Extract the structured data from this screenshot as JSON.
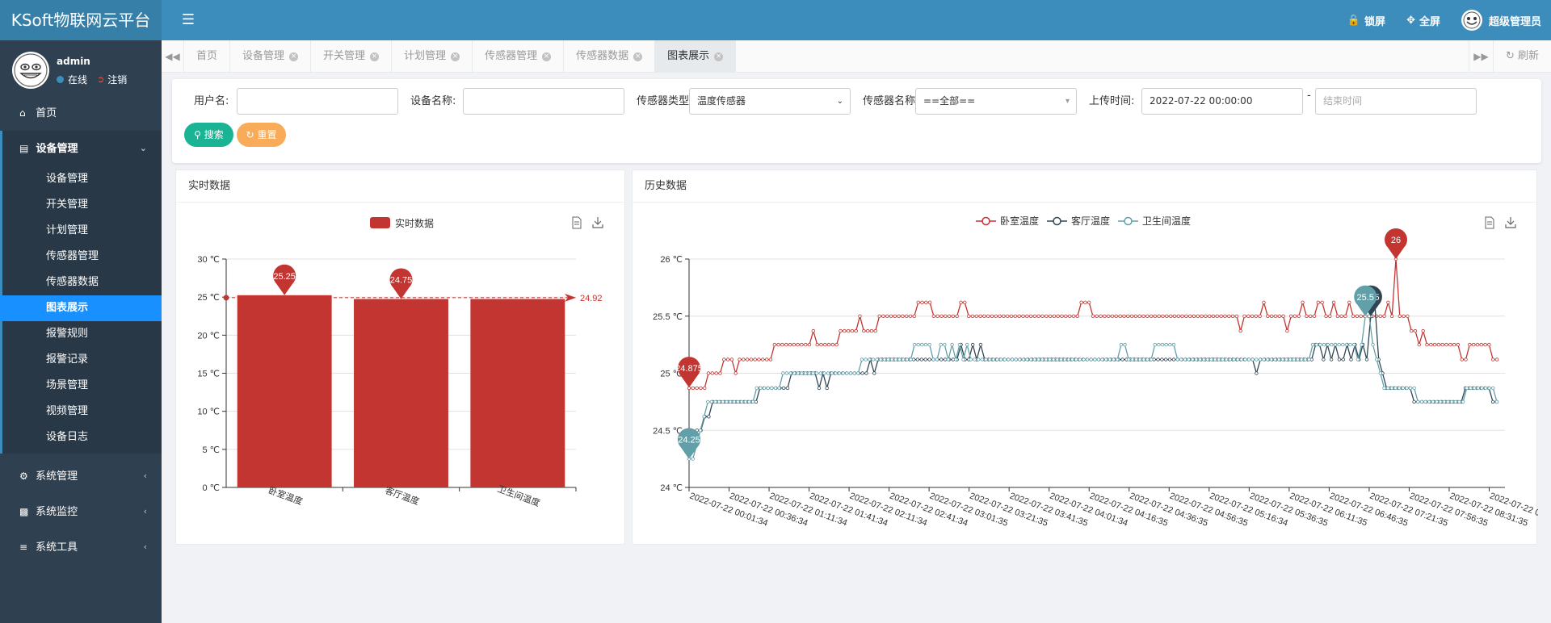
{
  "app": {
    "title": "KSoft物联网云平台"
  },
  "header": {
    "menu_icon": "hamburger-icon",
    "lock_label": "锁屏",
    "fullscreen_label": "全屏",
    "user_label": "超级管理员"
  },
  "sidebar": {
    "user": {
      "name": "admin",
      "status": "在线",
      "logout": "注销"
    },
    "home": "首页",
    "device_group": "设备管理",
    "items": [
      "设备管理",
      "开关管理",
      "计划管理",
      "传感器管理",
      "传感器数据",
      "图表展示",
      "报警规则",
      "报警记录",
      "场景管理",
      "视频管理",
      "设备日志"
    ],
    "active_item": "图表展示",
    "system_manage": "系统管理",
    "system_monitor": "系统监控",
    "system_tools": "系统工具"
  },
  "tabs": {
    "items": [
      "首页",
      "设备管理",
      "开关管理",
      "计划管理",
      "传感器管理",
      "传感器数据",
      "图表展示"
    ],
    "active": "图表展示",
    "refresh_label": "刷新"
  },
  "search": {
    "username_label": "用户名:",
    "username_value": "",
    "device_label": "设备名称:",
    "device_value": "",
    "sensor_type_label": "传感器类型",
    "sensor_type_value": "温度传感器",
    "sensor_name_label": "传感器名称",
    "sensor_name_value": "==全部==",
    "upload_time_label": "上传时间:",
    "start_time_value": "2022-07-22 00:00:00",
    "time_separator": "-",
    "end_time_placeholder": "结束时间",
    "search_button": "搜索",
    "reset_button": "重置"
  },
  "panels": {
    "realtime_title": "实时数据",
    "history_title": "历史数据"
  },
  "colors": {
    "bedroom": "#c23531",
    "livingroom": "#2f4554",
    "bathroom": "#61a0a8",
    "accent": "#3c8dbc",
    "active_menu": "#1890ff"
  },
  "chart_data": [
    {
      "type": "bar",
      "legend": [
        "实时数据"
      ],
      "categories": [
        "卧室温度",
        "客厅温度",
        "卫生间温度"
      ],
      "values": [
        25.25,
        24.75,
        24.75
      ],
      "markpoint_labels": [
        "25.25",
        "24.75"
      ],
      "markline_value": 24.92,
      "markline_label": "24.92",
      "ylim": [
        0,
        30
      ],
      "yticks": [
        "0 ℃",
        "5 ℃",
        "10 ℃",
        "15 ℃",
        "20 ℃",
        "25 ℃",
        "30 ℃"
      ],
      "grid": true,
      "legend_position": "top-center"
    },
    {
      "type": "line",
      "series": [
        {
          "name": "卧室温度",
          "values": [
            24.87,
            24.87,
            24.87,
            24.87,
            24.87,
            25,
            25,
            25,
            25,
            25.12,
            25.12,
            25.12,
            25,
            25.12,
            25.12,
            25.12,
            25.12,
            25.12,
            25.12,
            25.12,
            25.12,
            25.12,
            25.25,
            25.25,
            25.25,
            25.25,
            25.25,
            25.25,
            25.25,
            25.25,
            25.25,
            25.25,
            25.37,
            25.25,
            25.25,
            25.25,
            25.25,
            25.25,
            25.25,
            25.37,
            25.37,
            25.37,
            25.37,
            25.37,
            25.5,
            25.37,
            25.37,
            25.37,
            25.37,
            25.5,
            25.5,
            25.5,
            25.5,
            25.5,
            25.5,
            25.5,
            25.5,
            25.5,
            25.5,
            25.62,
            25.62,
            25.62,
            25.62,
            25.5,
            25.5,
            25.5,
            25.5,
            25.5,
            25.5,
            25.5,
            25.62,
            25.62,
            25.5,
            25.5,
            25.5,
            25.5,
            25.5,
            25.5,
            25.5,
            25.5,
            25.5,
            25.5,
            25.5,
            25.5,
            25.5,
            25.5,
            25.5,
            25.5,
            25.5,
            25.5,
            25.5,
            25.5,
            25.5,
            25.5,
            25.5,
            25.5,
            25.5,
            25.5,
            25.5,
            25.5,
            25.5,
            25.62,
            25.62,
            25.62,
            25.5,
            25.5,
            25.5,
            25.5,
            25.5,
            25.5,
            25.5,
            25.5,
            25.5,
            25.5,
            25.5,
            25.5,
            25.5,
            25.5,
            25.5,
            25.5,
            25.5,
            25.5,
            25.5,
            25.5,
            25.5,
            25.5,
            25.5,
            25.5,
            25.5,
            25.5,
            25.5,
            25.5,
            25.5,
            25.5,
            25.5,
            25.5,
            25.5,
            25.5,
            25.5,
            25.5,
            25.5,
            25.5,
            25.37,
            25.5,
            25.5,
            25.5,
            25.5,
            25.5,
            25.62,
            25.5,
            25.5,
            25.5,
            25.5,
            25.5,
            25.37,
            25.5,
            25.5,
            25.5,
            25.62,
            25.5,
            25.5,
            25.5,
            25.62,
            25.62,
            25.5,
            25.5,
            25.62,
            25.5,
            25.5,
            25.5,
            25.62,
            25.5,
            25.5,
            25.5,
            25.5,
            25.5,
            25.5,
            25.5,
            25.5,
            25.5,
            25.62,
            25.5,
            26,
            25.5,
            25.5,
            25.5,
            25.37,
            25.37,
            25.25,
            25.37,
            25.25,
            25.25,
            25.25,
            25.25,
            25.25,
            25.25,
            25.25,
            25.25,
            25.25,
            25.12,
            25.12,
            25.25,
            25.25,
            25.25,
            25.25,
            25.25,
            25.25,
            25.12,
            25.12
          ]
        },
        {
          "name": "客厅温度",
          "values": [
            24.37,
            24.37,
            24.5,
            24.5,
            24.62,
            24.62,
            24.75,
            24.75,
            24.75,
            24.75,
            24.75,
            24.75,
            24.75,
            24.75,
            24.75,
            24.75,
            24.75,
            24.75,
            24.87,
            24.87,
            24.87,
            24.87,
            24.87,
            24.87,
            24.87,
            24.87,
            25,
            25,
            25,
            25,
            25,
            25,
            25,
            24.87,
            25,
            24.87,
            25,
            25,
            25,
            25,
            25,
            25,
            25,
            25,
            25,
            25,
            25.12,
            25,
            25.12,
            25.12,
            25.12,
            25.12,
            25.12,
            25.12,
            25.12,
            25.12,
            25.12,
            25.12,
            25.12,
            25.12,
            25.12,
            25.12,
            25.12,
            25.12,
            25.12,
            25.12,
            25.12,
            25.12,
            25.12,
            25.25,
            25.12,
            25.12,
            25.25,
            25.12,
            25.25,
            25.12,
            25.12,
            25.12,
            25.12,
            25.12,
            25.12,
            25.12,
            25.12,
            25.12,
            25.12,
            25.12,
            25.12,
            25.12,
            25.12,
            25.12,
            25.12,
            25.12,
            25.12,
            25.12,
            25.12,
            25.12,
            25.12,
            25.12,
            25.12,
            25.12,
            25.12,
            25.12,
            25.12,
            25.12,
            25.12,
            25.12,
            25.12,
            25.12,
            25.12,
            25.12,
            25.12,
            25.12,
            25.12,
            25.12,
            25.12,
            25.12,
            25.12,
            25.12,
            25.12,
            25.12,
            25.12,
            25.12,
            25.12,
            25.12,
            25.12,
            25.12,
            25.12,
            25.12,
            25.12,
            25.12,
            25.12,
            25.12,
            25.12,
            25.12,
            25.12,
            25.12,
            25.12,
            25.12,
            25.12,
            25.12,
            25.12,
            25.12,
            25.12,
            25.12,
            25,
            25.12,
            25.12,
            25.12,
            25.12,
            25.12,
            25.12,
            25.12,
            25.12,
            25.12,
            25.12,
            25.12,
            25.12,
            25.12,
            25.12,
            25.25,
            25.25,
            25.12,
            25.25,
            25.12,
            25.25,
            25.12,
            25.12,
            25.25,
            25.12,
            25.25,
            25.12,
            25.25,
            25.12,
            25.5,
            25.62,
            25.12,
            25,
            24.87,
            24.87,
            24.87,
            24.87,
            24.87,
            24.87,
            24.87,
            24.75,
            24.75,
            24.75,
            24.75,
            24.75,
            24.75,
            24.75,
            24.75,
            24.75,
            24.75,
            24.75,
            24.75,
            24.75,
            24.87,
            24.87,
            24.87,
            24.87,
            24.87,
            24.87,
            24.87,
            24.75,
            24.75
          ]
        },
        {
          "name": "卫生间温度",
          "values": [
            24.25,
            24.25,
            24.37,
            24.5,
            24.62,
            24.75,
            24.75,
            24.75,
            24.75,
            24.75,
            24.75,
            24.75,
            24.75,
            24.75,
            24.75,
            24.75,
            24.75,
            24.75,
            24.87,
            24.87,
            24.87,
            24.87,
            24.87,
            24.87,
            24.87,
            25,
            25,
            25,
            25,
            25,
            25,
            25,
            25,
            25,
            25,
            25,
            25,
            25,
            25,
            25,
            25,
            25,
            25,
            25,
            25,
            25,
            25.12,
            25.12,
            25.12,
            25.12,
            25.12,
            25.12,
            25.12,
            25.12,
            25.12,
            25.12,
            25.12,
            25.12,
            25.12,
            25.12,
            25.25,
            25.25,
            25.25,
            25.25,
            25.25,
            25.12,
            25.12,
            25.25,
            25.25,
            25.12,
            25.25,
            25.12,
            25.25,
            25.12,
            25.25,
            25.12,
            25.12,
            25.12,
            25.12,
            25.12,
            25.12,
            25.12,
            25.12,
            25.12,
            25.12,
            25.12,
            25.12,
            25.12,
            25.12,
            25.12,
            25.12,
            25.12,
            25.12,
            25.12,
            25.12,
            25.12,
            25.12,
            25.12,
            25.12,
            25.12,
            25.12,
            25.12,
            25.12,
            25.12,
            25.12,
            25.12,
            25.12,
            25.12,
            25.12,
            25.12,
            25.12,
            25.12,
            25.12,
            25.12,
            25.12,
            25.25,
            25.25,
            25.12,
            25.12,
            25.12,
            25.12,
            25.12,
            25.12,
            25.12,
            25.25,
            25.25,
            25.25,
            25.25,
            25.25,
            25.25,
            25.12,
            25.12,
            25.12,
            25.12,
            25.12,
            25.12,
            25.12,
            25.12,
            25.12,
            25.12,
            25.12,
            25.12,
            25.12,
            25.12,
            25.12,
            25.12,
            25.12,
            25.12,
            25.12,
            25.12,
            25.12,
            25.12,
            25.12,
            25.12,
            25.12,
            25.12,
            25.12,
            25.12,
            25.12,
            25.12,
            25.12,
            25.12,
            25.12,
            25.12,
            25.12,
            25.12,
            25.25,
            25.25,
            25.25,
            25.25,
            25.25,
            25.25,
            25.25,
            25.25,
            25.25,
            25.25,
            25.25,
            25.25,
            25.12,
            25.25,
            25.5,
            25.5,
            25.25,
            25.12,
            25,
            24.87,
            24.87,
            24.87,
            24.87,
            24.87,
            24.87,
            24.87,
            24.87,
            24.87,
            24.75,
            24.75,
            24.75,
            24.75,
            24.75,
            24.75,
            24.75,
            24.75,
            24.75,
            24.75,
            24.75,
            24.75,
            24.75,
            24.87,
            24.87,
            24.87,
            24.87,
            24.87,
            24.87,
            24.87,
            24.87,
            24.75
          ]
        }
      ],
      "x_labels": [
        "2022-07-22 00:01:34",
        "2022-07-22 00:36:34",
        "2022-07-22 01:11:34",
        "2022-07-22 01:41:34",
        "2022-07-22 02:11:34",
        "2022-07-22 02:41:34",
        "2022-07-22 03:01:35",
        "2022-07-22 03:21:35",
        "2022-07-22 03:41:35",
        "2022-07-22 04:01:34",
        "2022-07-22 04:16:35",
        "2022-07-22 04:36:35",
        "2022-07-22 04:56:35",
        "2022-07-22 05:16:34",
        "2022-07-22 05:36:35",
        "2022-07-22 06:11:35",
        "2022-07-22 06:46:35",
        "2022-07-22 07:21:35",
        "2022-07-22 07:56:35",
        "2022-07-22 08:31:35",
        "2022-07-22 0"
      ],
      "markpoints": [
        {
          "series": "卧室温度",
          "label": "26"
        },
        {
          "series": "卧室温度",
          "label": "24.875"
        },
        {
          "series": "客厅温度",
          "label": "25.5"
        },
        {
          "series": "客厅温度",
          "label": "24.25"
        },
        {
          "series": "卫生间温度",
          "label": "25.5"
        },
        {
          "series": "卫生间温度",
          "label": "24.25"
        }
      ],
      "ylim": [
        24,
        26
      ],
      "yticks": [
        "24 ℃",
        "24.5 ℃",
        "25 ℃",
        "25.5 ℃",
        "26 ℃"
      ],
      "grid": true,
      "legend_position": "top-center"
    }
  ]
}
